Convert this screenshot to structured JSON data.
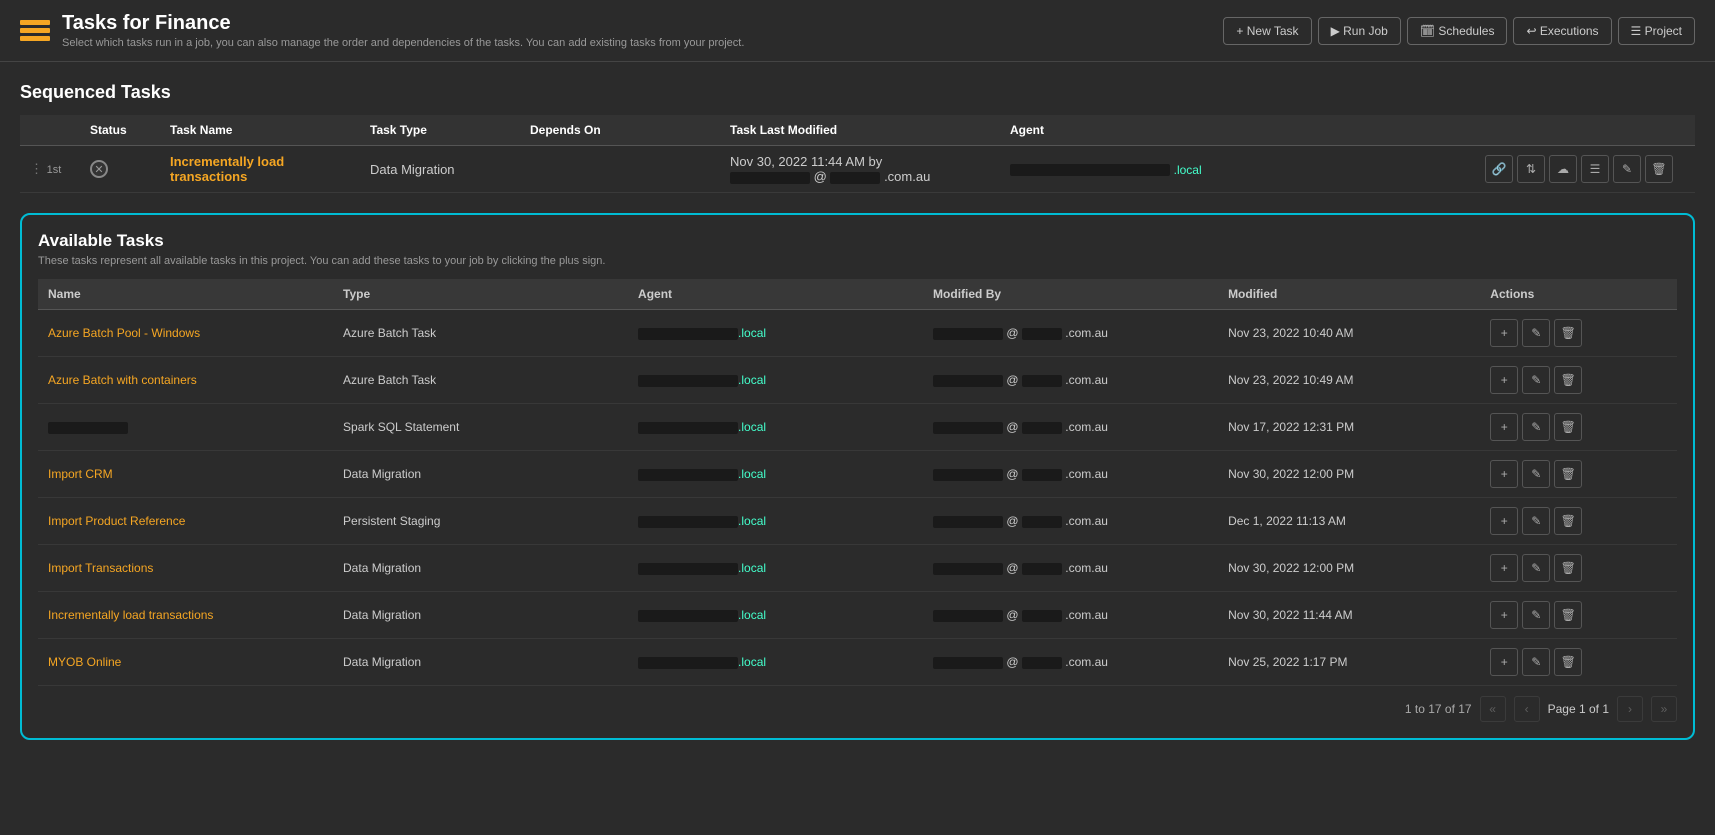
{
  "header": {
    "title": "Tasks for Finance",
    "subtitle": "Select which tasks run in a job, you can also manage the order and dependencies of the tasks. You can add existing tasks from your project.",
    "buttons": [
      {
        "label": "+ New Task",
        "name": "new-task-button"
      },
      {
        "label": "▶ Run Job",
        "name": "run-job-button"
      },
      {
        "label": "🗓 Schedules",
        "name": "schedules-button"
      },
      {
        "label": "↩ Executions",
        "name": "executions-button"
      },
      {
        "label": "☰ Project",
        "name": "project-button"
      }
    ]
  },
  "sequenced_tasks": {
    "title": "Sequenced Tasks",
    "columns": [
      "Status",
      "Task Name",
      "Task Type",
      "Depends On",
      "Task Last Modified",
      "Agent"
    ],
    "rows": [
      {
        "position": "1st",
        "status": "x",
        "task_name": "Incrementally load transactions",
        "task_type": "Data Migration",
        "depends_on": "",
        "last_modified": "Nov 30, 2022 11:44 AM by",
        "last_modified_user": "@ .com.au",
        "agent_suffix": "local"
      }
    ]
  },
  "available_tasks": {
    "title": "Available Tasks",
    "subtitle": "These tasks represent all available tasks in this project. You can add these tasks to your job by clicking the plus sign.",
    "columns": [
      "Name",
      "Type",
      "Agent",
      "Modified By",
      "Modified",
      "Actions"
    ],
    "rows": [
      {
        "name": "Azure Batch Pool - Windows",
        "type": "Azure Batch Task",
        "agent_suffix": "local",
        "modified_suffix": ".com.au",
        "modified": "Nov 23, 2022 10:40 AM"
      },
      {
        "name": "Azure Batch with containers",
        "type": "Azure Batch Task",
        "agent_suffix": "local",
        "modified_suffix": ".com.au",
        "modified": "Nov 23, 2022 10:49 AM"
      },
      {
        "name": "[redacted]",
        "type": "Spark SQL Statement",
        "agent_suffix": "local",
        "modified_suffix": ".com.au",
        "modified": "Nov 17, 2022 12:31 PM"
      },
      {
        "name": "Import CRM",
        "type": "Data Migration",
        "agent_suffix": "local",
        "modified_suffix": ".com.au",
        "modified": "Nov 30, 2022 12:00 PM"
      },
      {
        "name": "Import Product Reference",
        "type": "Persistent Staging",
        "agent_suffix": "local",
        "modified_suffix": ".com.au",
        "modified": "Dec 1, 2022 11:13 AM"
      },
      {
        "name": "Import Transactions",
        "type": "Data Migration",
        "agent_suffix": "local",
        "modified_suffix": ".com.au",
        "modified": "Nov 30, 2022 12:00 PM"
      },
      {
        "name": "Incrementally load transactions",
        "type": "Data Migration",
        "agent_suffix": "local",
        "modified_suffix": ".com.au",
        "modified": "Nov 30, 2022 11:44 AM"
      },
      {
        "name": "MYOB Online",
        "type": "Data Migration",
        "agent_suffix": "local",
        "modified_suffix": ".com.au",
        "modified": "Nov 25, 2022 1:17 PM"
      }
    ],
    "pagination": {
      "range_text": "1 to 17 of 17",
      "page_label": "Page 1 of 1"
    }
  }
}
